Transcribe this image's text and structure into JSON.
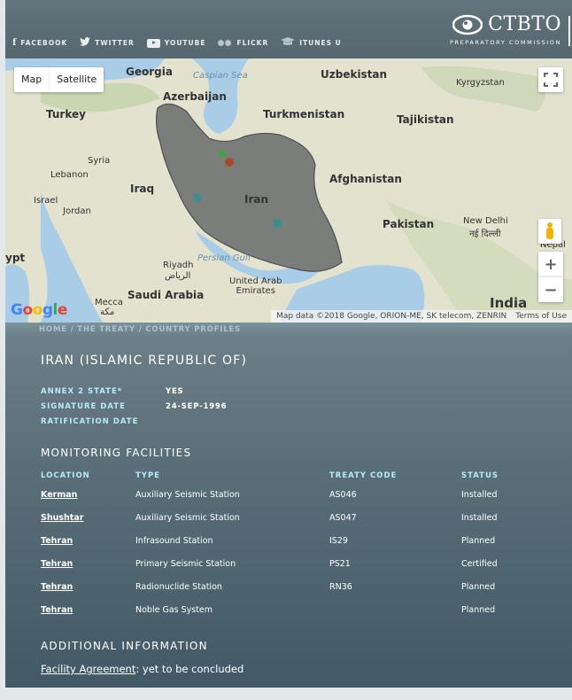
{
  "header": {
    "social": [
      {
        "label": "FACEBOOK",
        "icon": "facebook-icon"
      },
      {
        "label": "TWITTER",
        "icon": "twitter-icon"
      },
      {
        "label": "YOUTUBE",
        "icon": "youtube-icon"
      },
      {
        "label": "FLICKR",
        "icon": "flickr-icon"
      },
      {
        "label": "ITUNES U",
        "icon": "itunes-u-icon"
      }
    ],
    "logo_name": "CTBTO",
    "logo_sub": "PREPARATORY COMMISSION"
  },
  "map": {
    "type_map": "Map",
    "type_satellite": "Satellite",
    "labels": {
      "georgia": "Georgia",
      "caspian": "Caspian Sea",
      "uzbekistan": "Uzbekistan",
      "kyrgyzstan": "Kyrgyzstan",
      "azerbaijan": "Azerbaijan",
      "turkey": "Turkey",
      "turkmenistan": "Turkmenistan",
      "tajikistan": "Tajikistan",
      "syria": "Syria",
      "lebanon": "Lebanon",
      "iraq": "Iraq",
      "afghanistan": "Afghanistan",
      "israel": "Israel",
      "jordan": "Jordan",
      "iran": "Iran",
      "pakistan": "Pakistan",
      "newdelhi": "New Delhi",
      "newdelhi_local": "नई दिल्ली",
      "nepal": "Nepal",
      "egypt": "ypt",
      "persian_gulf": "Persian Gulf",
      "riyadh": "Riyadh",
      "riyadh_local": "الرياض",
      "uae": "United Arab\nEmirates",
      "saudi": "Saudi Arabia",
      "mecca": "Mecca",
      "mecca_local": "مكة",
      "india": "India"
    },
    "google": "Google",
    "attribution": "Map data ©2018 Google, ORION-ME, SK telecom, ZENRIN",
    "terms": "Terms of Use",
    "zoom_in": "+",
    "zoom_out": "−"
  },
  "breadcrumb": {
    "home": "HOME",
    "sep": " / ",
    "treaty": "THE TREATY",
    "profiles": "COUNTRY PROFILES"
  },
  "country": {
    "title": "IRAN (ISLAMIC REPUBLIC OF)",
    "annex_label": "ANNEX 2 STATE*",
    "annex_value": "YES",
    "signature_label": "SIGNATURE DATE",
    "signature_value": "24-SEP-1996",
    "ratification_label": "RATIFICATION DATE"
  },
  "facilities": {
    "title": "MONITORING FACILITIES",
    "headers": {
      "location": "LOCATION",
      "type": "TYPE",
      "code": "TREATY CODE",
      "status": "STATUS"
    },
    "rows": [
      {
        "location": "Kerman",
        "type": "Auxiliary Seismic Station",
        "code": "AS046",
        "status": "Installed"
      },
      {
        "location": "Shushtar",
        "type": "Auxiliary Seismic Station",
        "code": "AS047",
        "status": "Installed"
      },
      {
        "location": "Tehran",
        "type": "Infrasound Station",
        "code": "IS29",
        "status": "Planned"
      },
      {
        "location": "Tehran",
        "type": "Primary Seismic Station",
        "code": "PS21",
        "status": "Certified"
      },
      {
        "location": "Tehran",
        "type": "Radionuclide Station",
        "code": "RN36",
        "status": "Planned"
      },
      {
        "location": "Tehran",
        "type": "Noble Gas System",
        "code": "",
        "status": "Planned"
      }
    ]
  },
  "additional": {
    "title": "ADDITIONAL INFORMATION",
    "link": "Facility Agreement",
    "text": ": yet to be concluded"
  },
  "colors": {
    "header": "#5d6e77",
    "accent_label": "#b7eaf6",
    "breadcrumb": "#a7c4d0",
    "iran_fill": "#7a7d7a"
  }
}
